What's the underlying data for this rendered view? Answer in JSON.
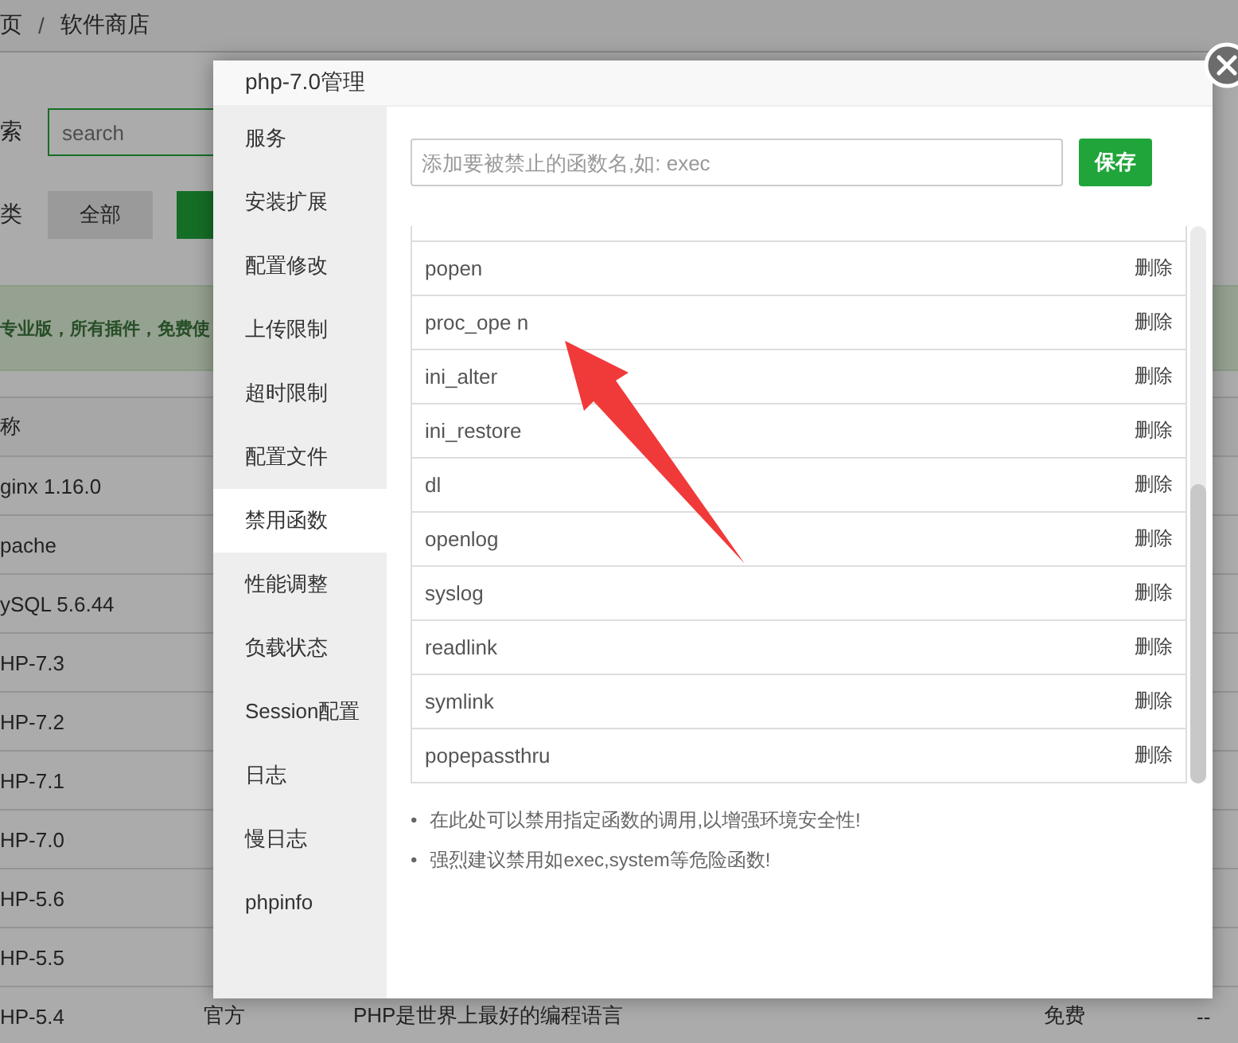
{
  "page": {
    "breadcrumb": [
      "页",
      "软件商店"
    ],
    "breadcrumb_separator": "/",
    "search": {
      "label": "索",
      "placeholder": "search"
    },
    "category": {
      "label": "类",
      "buttons": [
        {
          "label": "全部",
          "selected": false
        },
        {
          "selected": true
        }
      ]
    },
    "banner": "专业版，所有插件，免费使",
    "table": {
      "columns": [
        "称"
      ],
      "rows": [
        {
          "name": "ginx 1.16.0"
        },
        {
          "name": "pache"
        },
        {
          "name": "ySQL 5.6.44"
        },
        {
          "name": "HP-7.3"
        },
        {
          "name": "HP-7.2"
        },
        {
          "name": "HP-7.1"
        },
        {
          "name": "HP-7.0"
        },
        {
          "name": "HP-5.6"
        },
        {
          "name": "HP-5.5"
        },
        {
          "name": "HP-5.4",
          "type": "官方",
          "description": "PHP是世界上最好的编程语言",
          "price": "免费",
          "ops": "--"
        }
      ]
    }
  },
  "dialog": {
    "title": "php-7.0管理",
    "nav": [
      {
        "label": "服务",
        "selected": false
      },
      {
        "label": "安装扩展",
        "selected": false
      },
      {
        "label": "配置修改",
        "selected": false
      },
      {
        "label": "上传限制",
        "selected": false
      },
      {
        "label": "超时限制",
        "selected": false
      },
      {
        "label": "配置文件",
        "selected": false
      },
      {
        "label": "禁用函数",
        "selected": true
      },
      {
        "label": "性能调整",
        "selected": false
      },
      {
        "label": "负载状态",
        "selected": false
      },
      {
        "label": "Session配置",
        "selected": false
      },
      {
        "label": "日志",
        "selected": false
      },
      {
        "label": "慢日志",
        "selected": false
      },
      {
        "label": "phpinfo",
        "selected": false
      }
    ],
    "input": {
      "placeholder": "添加要被禁止的函数名,如: exec"
    },
    "save_button": "保存",
    "functions": [
      {
        "name": "popen",
        "action": "删除"
      },
      {
        "name": "proc_ope n",
        "action": "删除"
      },
      {
        "name": "ini_alter",
        "action": "删除"
      },
      {
        "name": "ini_restore",
        "action": "删除"
      },
      {
        "name": "dl",
        "action": "删除"
      },
      {
        "name": "openlog",
        "action": "删除"
      },
      {
        "name": "syslog",
        "action": "删除"
      },
      {
        "name": "readlink",
        "action": "删除"
      },
      {
        "name": "symlink",
        "action": "删除"
      },
      {
        "name": "popepassthru",
        "action": "删除"
      }
    ],
    "note_bullet": "•",
    "notes": [
      "在此处可以禁用指定函数的调用,以增强环境安全性!",
      "强烈建议禁用如exec,system等危险函数!"
    ]
  }
}
